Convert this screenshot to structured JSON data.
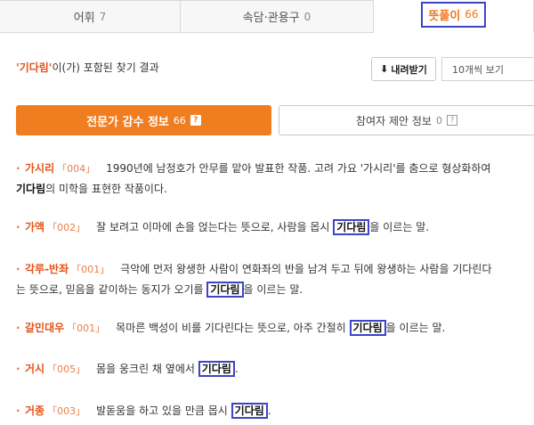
{
  "tabs": [
    {
      "label": "어휘",
      "count": "7"
    },
    {
      "label": "속담·관용구",
      "count": "0"
    },
    {
      "label": "뜻풀이",
      "count": "66"
    }
  ],
  "result": {
    "keyword": "'기다림'",
    "suffix": "이(가) 포함된 찾기 결과"
  },
  "toolbar": {
    "download_label": "내려받기",
    "view_select": "10개씩 보기"
  },
  "subtabs": {
    "expert_label": "전문가 감수 정보",
    "expert_count": "66",
    "user_label": "참여자 제안 정보",
    "user_count": "0"
  },
  "entries": [
    {
      "word": "가시리",
      "code": "「004」",
      "text1": "1990년에 남정호가 안무를 맡아 발표한 작품. 고려 가요 '가시리'를 춤으로 형상화하여",
      "kw": "기다림",
      "text2": "의 미학을 표현한 작품이다."
    },
    {
      "word": "가액",
      "code": "「002」",
      "pre": "잘 보려고 이마에 손을 얹는다는 뜻으로, 사람을 몹시",
      "kw": "기다림",
      "post": "을 이르는 말."
    },
    {
      "word": "각루-반좌",
      "code": "「001」",
      "text1": "극악에 먼저 왕생한 사람이 연화좌의 반을 남겨 두고 뒤에 왕생하는 사람을 기다린다",
      "pre2": "는 뜻으로, 믿음을 같이하는 동지가 오기를",
      "kw": "기다림",
      "post": "을 이르는 말."
    },
    {
      "word": "갈민대우",
      "code": "「001」",
      "pre": "목마른 백성이 비를 기다린다는 뜻으로, 아주 간절히",
      "kw": "기다림",
      "post": "을 이르는 말."
    },
    {
      "word": "거시",
      "code": "「005」",
      "pre": "몸을 웅크린 채 옆에서",
      "kw": "기다림",
      "post": "."
    },
    {
      "word": "거종",
      "code": "「003」",
      "pre": "발돋움을 하고 있을 만큼 몹시",
      "kw": "기다림",
      "post": "."
    }
  ]
}
